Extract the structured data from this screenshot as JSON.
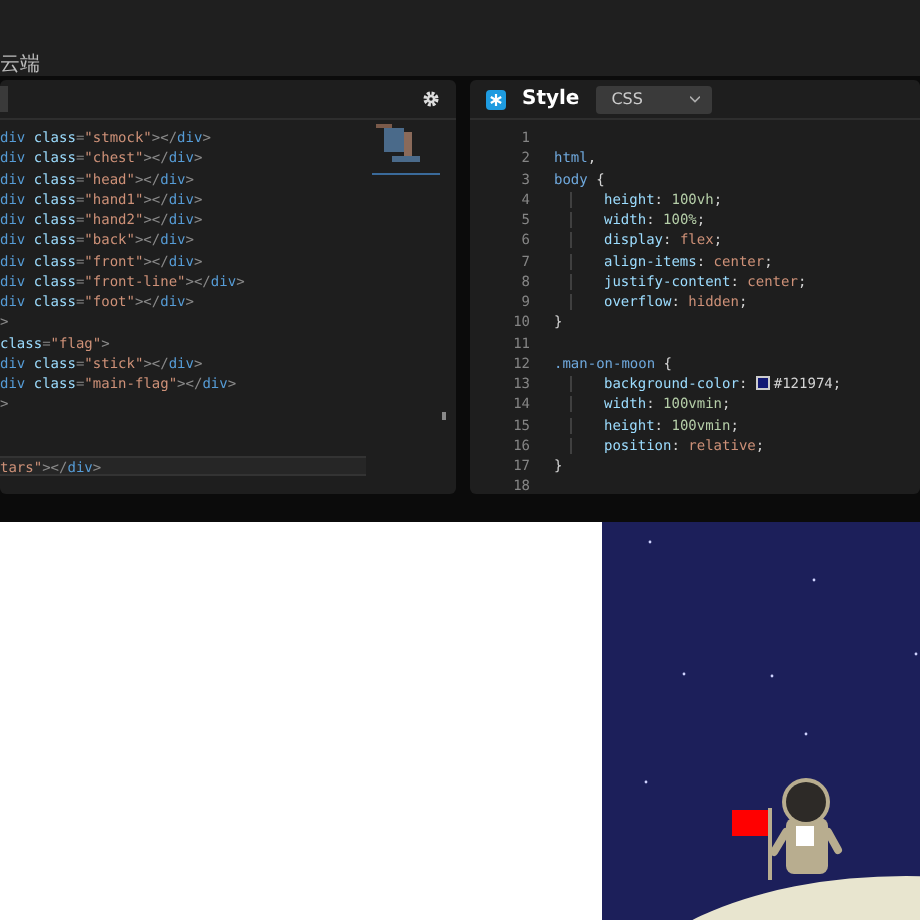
{
  "top_bar": {
    "text": "云端"
  },
  "html_panel": {
    "lines": [
      {
        "current": false,
        "tokens": [
          {
            "kind": "tag",
            "text": "div"
          },
          {
            "kind": "attr",
            "text": " class"
          },
          {
            "kind": "punct",
            "text": "="
          },
          {
            "kind": "string",
            "text": "\"stmock\""
          },
          {
            "kind": "punct",
            "text": "></"
          },
          {
            "kind": "tag",
            "text": "div"
          },
          {
            "kind": "punct",
            "text": ">"
          }
        ]
      },
      {
        "current": false,
        "tokens": [
          {
            "kind": "tag",
            "text": "div"
          },
          {
            "kind": "attr",
            "text": " class"
          },
          {
            "kind": "punct",
            "text": "="
          },
          {
            "kind": "string",
            "text": "\"chest\""
          },
          {
            "kind": "punct",
            "text": "></"
          },
          {
            "kind": "tag",
            "text": "div"
          },
          {
            "kind": "punct",
            "text": ">"
          }
        ]
      },
      {
        "current": false,
        "tokens": [
          {
            "kind": "tag",
            "text": "div"
          },
          {
            "kind": "attr",
            "text": " class"
          },
          {
            "kind": "punct",
            "text": "="
          },
          {
            "kind": "string",
            "text": "\"head\""
          },
          {
            "kind": "punct",
            "text": "></"
          },
          {
            "kind": "tag",
            "text": "div"
          },
          {
            "kind": "punct",
            "text": ">"
          }
        ]
      },
      {
        "current": false,
        "tokens": [
          {
            "kind": "tag",
            "text": "div"
          },
          {
            "kind": "attr",
            "text": " class"
          },
          {
            "kind": "punct",
            "text": "="
          },
          {
            "kind": "string",
            "text": "\"hand1\""
          },
          {
            "kind": "punct",
            "text": "></"
          },
          {
            "kind": "tag",
            "text": "div"
          },
          {
            "kind": "punct",
            "text": ">"
          }
        ]
      },
      {
        "current": false,
        "tokens": [
          {
            "kind": "tag",
            "text": "div"
          },
          {
            "kind": "attr",
            "text": " class"
          },
          {
            "kind": "punct",
            "text": "="
          },
          {
            "kind": "string",
            "text": "\"hand2\""
          },
          {
            "kind": "punct",
            "text": "></"
          },
          {
            "kind": "tag",
            "text": "div"
          },
          {
            "kind": "punct",
            "text": ">"
          }
        ]
      },
      {
        "current": false,
        "tokens": [
          {
            "kind": "tag",
            "text": "div"
          },
          {
            "kind": "attr",
            "text": " class"
          },
          {
            "kind": "punct",
            "text": "="
          },
          {
            "kind": "string",
            "text": "\"back\""
          },
          {
            "kind": "punct",
            "text": "></"
          },
          {
            "kind": "tag",
            "text": "div"
          },
          {
            "kind": "punct",
            "text": ">"
          }
        ]
      },
      {
        "current": false,
        "tokens": [
          {
            "kind": "tag",
            "text": "div"
          },
          {
            "kind": "attr",
            "text": " class"
          },
          {
            "kind": "punct",
            "text": "="
          },
          {
            "kind": "string",
            "text": "\"front\""
          },
          {
            "kind": "punct",
            "text": "></"
          },
          {
            "kind": "tag",
            "text": "div"
          },
          {
            "kind": "punct",
            "text": ">"
          }
        ]
      },
      {
        "current": false,
        "tokens": [
          {
            "kind": "tag",
            "text": "div"
          },
          {
            "kind": "attr",
            "text": " class"
          },
          {
            "kind": "punct",
            "text": "="
          },
          {
            "kind": "string",
            "text": "\"front-line\""
          },
          {
            "kind": "punct",
            "text": "></"
          },
          {
            "kind": "tag",
            "text": "div"
          },
          {
            "kind": "punct",
            "text": ">"
          }
        ]
      },
      {
        "current": false,
        "tokens": [
          {
            "kind": "tag",
            "text": "div"
          },
          {
            "kind": "attr",
            "text": " class"
          },
          {
            "kind": "punct",
            "text": "="
          },
          {
            "kind": "string",
            "text": "\"foot\""
          },
          {
            "kind": "punct",
            "text": "></"
          },
          {
            "kind": "tag",
            "text": "div"
          },
          {
            "kind": "punct",
            "text": ">"
          }
        ]
      },
      {
        "current": false,
        "tokens": [
          {
            "kind": "punct",
            "text": ">"
          }
        ]
      },
      {
        "current": false,
        "tokens": [
          {
            "kind": "attr",
            "text": "class"
          },
          {
            "kind": "punct",
            "text": "="
          },
          {
            "kind": "string",
            "text": "\"flag\""
          },
          {
            "kind": "punct",
            "text": ">"
          }
        ]
      },
      {
        "current": false,
        "tokens": [
          {
            "kind": "tag",
            "text": "div"
          },
          {
            "kind": "attr",
            "text": " class"
          },
          {
            "kind": "punct",
            "text": "="
          },
          {
            "kind": "string",
            "text": "\"stick\""
          },
          {
            "kind": "punct",
            "text": "></"
          },
          {
            "kind": "tag",
            "text": "div"
          },
          {
            "kind": "punct",
            "text": ">"
          }
        ]
      },
      {
        "current": false,
        "tokens": [
          {
            "kind": "tag",
            "text": "div"
          },
          {
            "kind": "attr",
            "text": " class"
          },
          {
            "kind": "punct",
            "text": "="
          },
          {
            "kind": "string",
            "text": "\"main-flag\""
          },
          {
            "kind": "punct",
            "text": "></"
          },
          {
            "kind": "tag",
            "text": "div"
          },
          {
            "kind": "punct",
            "text": ">"
          }
        ]
      },
      {
        "current": false,
        "tokens": [
          {
            "kind": "punct",
            "text": ">"
          }
        ]
      },
      {
        "current": false
      },
      {
        "current": false
      },
      {
        "current": true,
        "tokens": [
          {
            "kind": "string",
            "text": "tars\""
          },
          {
            "kind": "punct",
            "text": "></"
          },
          {
            "kind": "tag",
            "text": "div"
          },
          {
            "kind": "punct",
            "text": ">"
          }
        ]
      }
    ]
  },
  "style_panel": {
    "title": "Style",
    "language": "CSS",
    "lines": [
      {
        "number": "1",
        "indented": false
      },
      {
        "number": "2",
        "indented": false,
        "tokens": [
          {
            "kind": "selector",
            "text": "html"
          },
          {
            "kind": "plain",
            "text": ","
          }
        ]
      },
      {
        "number": "3",
        "indented": false,
        "tokens": [
          {
            "kind": "selector",
            "text": "body"
          },
          {
            "kind": "plain",
            "text": " {"
          }
        ]
      },
      {
        "number": "4",
        "indented": true,
        "tokens": [
          {
            "kind": "prop",
            "text": "height"
          },
          {
            "kind": "plain",
            "text": ": "
          },
          {
            "kind": "num",
            "text": "100vh"
          },
          {
            "kind": "plain",
            "text": ";"
          }
        ]
      },
      {
        "number": "5",
        "indented": true,
        "tokens": [
          {
            "kind": "prop",
            "text": "width"
          },
          {
            "kind": "plain",
            "text": ": "
          },
          {
            "kind": "num",
            "text": "100%"
          },
          {
            "kind": "plain",
            "text": ";"
          }
        ]
      },
      {
        "number": "6",
        "indented": true,
        "tokens": [
          {
            "kind": "prop",
            "text": "display"
          },
          {
            "kind": "plain",
            "text": ": "
          },
          {
            "kind": "value",
            "text": "flex"
          },
          {
            "kind": "plain",
            "text": ";"
          }
        ]
      },
      {
        "number": "7",
        "indented": true,
        "tokens": [
          {
            "kind": "prop",
            "text": "align-items"
          },
          {
            "kind": "plain",
            "text": ": "
          },
          {
            "kind": "value",
            "text": "center"
          },
          {
            "kind": "plain",
            "text": ";"
          }
        ]
      },
      {
        "number": "8",
        "indented": true,
        "tokens": [
          {
            "kind": "prop",
            "text": "justify-content"
          },
          {
            "kind": "plain",
            "text": ": "
          },
          {
            "kind": "value",
            "text": "center"
          },
          {
            "kind": "plain",
            "text": ";"
          }
        ]
      },
      {
        "number": "9",
        "indented": true,
        "tokens": [
          {
            "kind": "prop",
            "text": "overflow"
          },
          {
            "kind": "plain",
            "text": ": "
          },
          {
            "kind": "value",
            "text": "hidden"
          },
          {
            "kind": "plain",
            "text": ";"
          }
        ]
      },
      {
        "number": "10",
        "indented": false,
        "tokens": [
          {
            "kind": "plain",
            "text": "}"
          }
        ]
      },
      {
        "number": "11",
        "indented": false
      },
      {
        "number": "12",
        "indented": false,
        "tokens": [
          {
            "kind": "selector",
            "text": ".man-on-moon"
          },
          {
            "kind": "plain",
            "text": " {"
          }
        ]
      },
      {
        "number": "13",
        "indented": true,
        "tokens": [
          {
            "kind": "prop",
            "text": "background-color"
          },
          {
            "kind": "plain",
            "text": ": "
          },
          {
            "kind": "swatch",
            "color": "#121974"
          },
          {
            "kind": "plain",
            "text": "#121974;"
          }
        ]
      },
      {
        "number": "14",
        "indented": true,
        "tokens": [
          {
            "kind": "prop",
            "text": "width"
          },
          {
            "kind": "plain",
            "text": ": "
          },
          {
            "kind": "num",
            "text": "100vmin"
          },
          {
            "kind": "plain",
            "text": ";"
          }
        ]
      },
      {
        "number": "15",
        "indented": true,
        "tokens": [
          {
            "kind": "prop",
            "text": "height"
          },
          {
            "kind": "plain",
            "text": ": "
          },
          {
            "kind": "num",
            "text": "100vmin"
          },
          {
            "kind": "plain",
            "text": ";"
          }
        ]
      },
      {
        "number": "16",
        "indented": true,
        "tokens": [
          {
            "kind": "prop",
            "text": "position"
          },
          {
            "kind": "plain",
            "text": ": "
          },
          {
            "kind": "value",
            "text": "relative"
          },
          {
            "kind": "plain",
            "text": ";"
          }
        ]
      },
      {
        "number": "17",
        "indented": false,
        "tokens": [
          {
            "kind": "plain",
            "text": "}"
          }
        ]
      },
      {
        "number": "18",
        "indented": false
      }
    ]
  }
}
